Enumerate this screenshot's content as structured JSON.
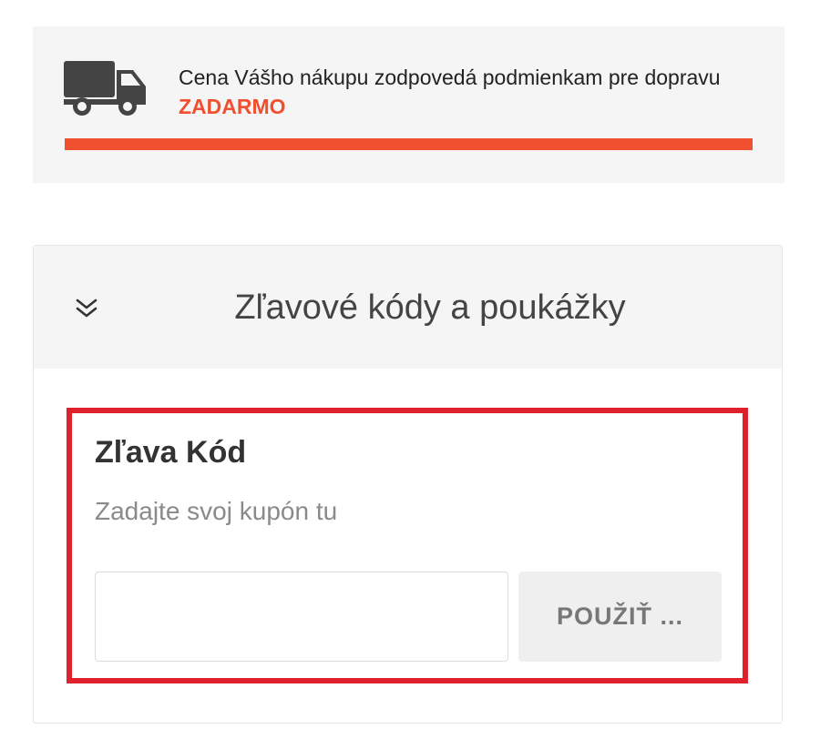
{
  "shipping": {
    "message": "Cena Vášho nákupu zodpovedá podmienkam pre dopravu",
    "highlight": "ZADARMO",
    "progress_percent": 100,
    "accent_color": "#f0502d",
    "icon": "truck-icon"
  },
  "coupon": {
    "header_title": "Zľavové kódy a poukážky",
    "toggle_icon": "double-chevron-down-icon",
    "label": "Zľava Kód",
    "hint": "Zadajte svoj kupón tu",
    "input_value": "",
    "apply_label": "POUŽIŤ ...",
    "frame_color": "#e0202a"
  }
}
